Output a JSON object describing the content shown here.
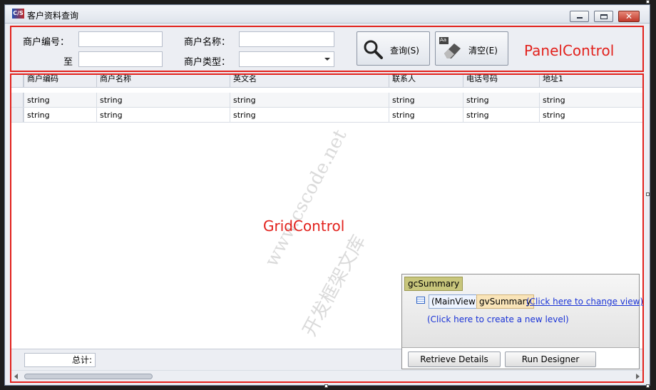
{
  "window": {
    "title": "客户资料查询",
    "icon_text": "C/S"
  },
  "filters": {
    "merchant_code_label": "商户编号：",
    "to_label": "至",
    "merchant_name_label": "商户名称：",
    "merchant_type_label": "商户类型：",
    "merchant_code_from": "",
    "merchant_code_to": "",
    "merchant_name": "",
    "merchant_type": ""
  },
  "buttons": {
    "query": "查询(S)",
    "clear": "清空(E)",
    "clear_icon_text": "Aa"
  },
  "captions": {
    "panel": "PanelControl",
    "grid": "GridControl"
  },
  "watermark": {
    "line1": "www.cscode.net",
    "line2": "开发框架文库"
  },
  "grid": {
    "columns": [
      "商户编码",
      "商户名称",
      "英文名",
      "联系人",
      "电话号码",
      "地址1"
    ],
    "rows": [
      [
        "string",
        "string",
        "string",
        "string",
        "string",
        "string"
      ],
      [
        "string",
        "string",
        "string",
        "string",
        "string",
        "string"
      ]
    ],
    "total_label": "总计:"
  },
  "designer": {
    "gc_tag": "gcSummary",
    "mainview": "(MainView)",
    "gv_tag": "gvSummary",
    "change_view": "(Click here to change view)",
    "new_level": "(Click here to create a new level)",
    "retrieve": "Retrieve Details",
    "run_designer": "Run Designer"
  }
}
